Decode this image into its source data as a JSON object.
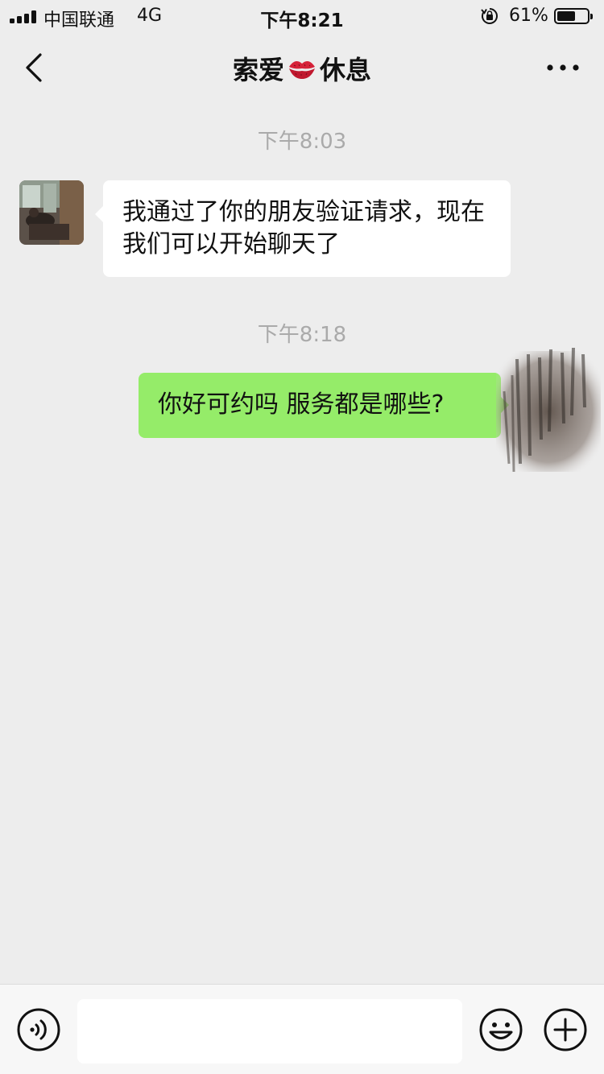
{
  "status_bar": {
    "carrier": "中国联通",
    "network": "4G",
    "time": "下午8:21",
    "battery_percent": "61%",
    "battery_level": 0.61,
    "icons": [
      "signal-bars",
      "orientation-lock-icon",
      "battery-icon"
    ]
  },
  "nav": {
    "title_left": "索爱",
    "title_emoji": "lips-icon",
    "title_right": "休息",
    "back_icon": "chevron-left-icon",
    "more_icon": "more-dots-icon"
  },
  "messages": [
    {
      "type": "time",
      "text": "下午8:03"
    },
    {
      "type": "incoming",
      "text": "我通过了你的朋友验证请求，现在我们可以开始聊天了"
    },
    {
      "type": "time",
      "text": "下午8:18"
    },
    {
      "type": "outgoing",
      "text": "你好可约吗 服务都是哪些?"
    }
  ],
  "input_bar": {
    "voice_icon": "voice-icon",
    "text_value": "",
    "emoji_icon": "emoji-icon",
    "plus_icon": "plus-icon"
  },
  "colors": {
    "background": "#ededed",
    "outgoing_bubble": "#95ec69",
    "incoming_bubble": "#ffffff",
    "timestamp": "#aaaaaa"
  }
}
